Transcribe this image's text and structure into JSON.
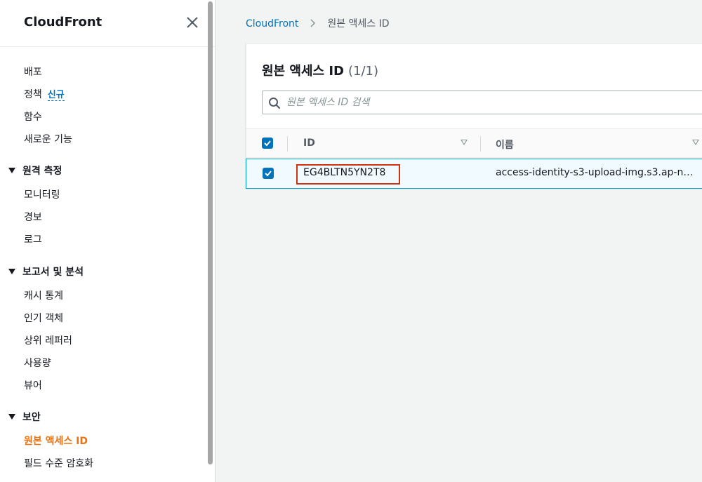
{
  "sidebar": {
    "title": "CloudFront",
    "items": [
      {
        "label": "배포"
      },
      {
        "label": "정책",
        "badge": "신규"
      },
      {
        "label": "함수"
      },
      {
        "label": "새로운 기능"
      }
    ],
    "sections": [
      {
        "label": "원격 측정",
        "items": [
          "모니터링",
          "경보",
          "로그"
        ]
      },
      {
        "label": "보고서 및 분석",
        "items": [
          "캐시 통계",
          "인기 객체",
          "상위 레퍼러",
          "사용량",
          "뷰어"
        ]
      },
      {
        "label": "보안",
        "items": [
          "원본 액세스 ID",
          "필드 수준 암호화"
        ]
      }
    ]
  },
  "breadcrumb": {
    "root": "CloudFront",
    "current": "원본 액세스 ID"
  },
  "panel": {
    "title": "원본 액세스 ID",
    "count": "(1/1)",
    "search_placeholder": "원본 액세스 ID 검색",
    "columns": {
      "id": "ID",
      "name": "이름"
    },
    "rows": [
      {
        "id": "EG4BLTN5YN2T8",
        "name": "access-identity-s3-upload-img.s3.ap-n…",
        "selected": true
      }
    ]
  },
  "colors": {
    "accent": "#ec7211",
    "link": "#0073bb",
    "highlight": "#d13212"
  }
}
